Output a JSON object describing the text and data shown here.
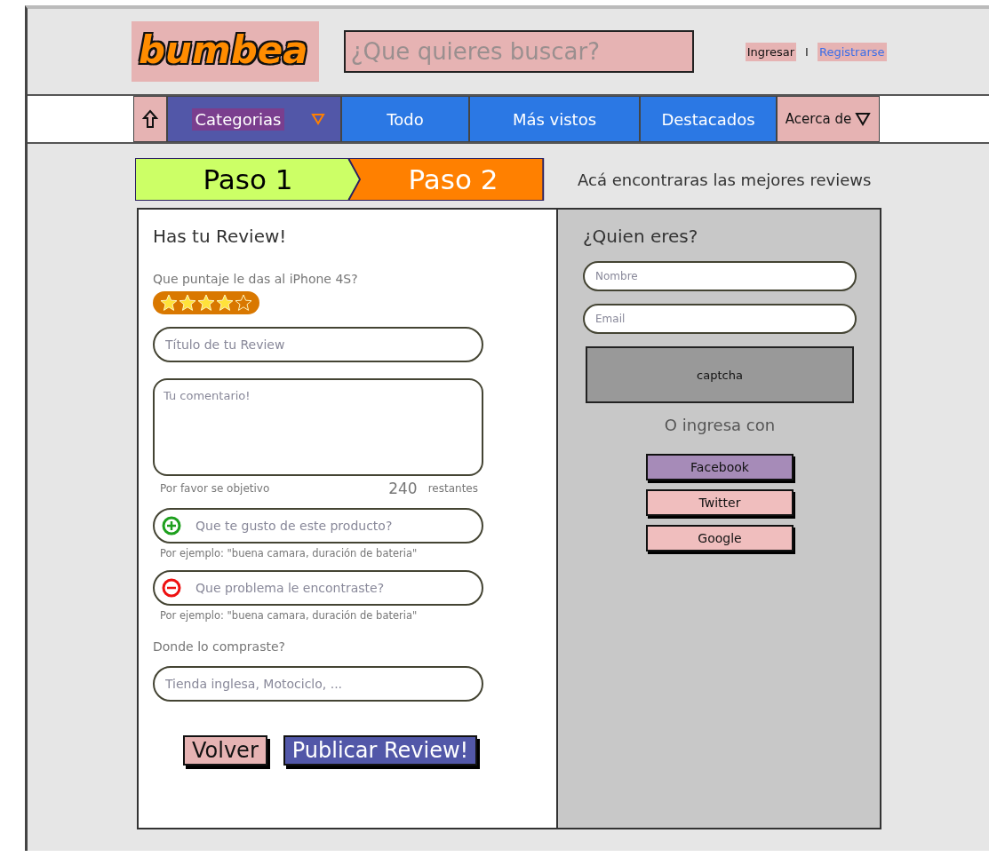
{
  "header": {
    "logo": "bumbea",
    "search": {
      "placeholder": "¿Que quieres buscar?"
    },
    "links": [
      {
        "label": "Ingresar",
        "kind": "plain"
      },
      {
        "label": "I",
        "kind": "separator"
      },
      {
        "label": "Registrarse",
        "kind": "link"
      }
    ]
  },
  "nav": [
    {
      "kind": "home"
    },
    {
      "label": "Categorias",
      "kind": "dropdown"
    },
    {
      "label": "Todo",
      "kind": "tab"
    },
    {
      "label": "Más vistos",
      "kind": "tab"
    },
    {
      "label": "Destacados",
      "kind": "tab"
    },
    {
      "label": "Acerca de",
      "kind": "menu"
    }
  ],
  "steps": [
    {
      "label": "Paso 1",
      "color": "#ccff66"
    },
    {
      "label": "Paso 2",
      "color": "#ff8000"
    }
  ],
  "tagline": "Acá encontraras las mejores reviews",
  "review": {
    "title": "Has tu Review!",
    "rating_label": "Que puntaje le das al iPhone 4S?",
    "stars": 4,
    "title_field": {
      "placeholder": "Título de tu Review"
    },
    "comment": {
      "placeholder": "Tu comentario!",
      "hint": "Por favor se objetivo",
      "remaining": "240",
      "remaining_label": "restantes"
    },
    "pros": {
      "placeholder": "Que te gusto de este producto?",
      "hint": "Por ejemplo: \"buena camara, duración de bateria\""
    },
    "cons": {
      "placeholder": "Que problema le encontraste?",
      "hint": "Por ejemplo: \"buena camara, duración de bateria\""
    },
    "store_label": "Donde lo compraste?",
    "store": {
      "placeholder": "Tienda inglesa, Motociclo, ..."
    },
    "buttons": [
      {
        "label": "Volver",
        "kind": "secondary"
      },
      {
        "label": "Publicar Review!",
        "kind": "primary"
      }
    ]
  },
  "identity": {
    "title": "¿Quien eres?",
    "name": {
      "placeholder": "Nombre"
    },
    "email": {
      "placeholder": "Email"
    },
    "captcha": "captcha",
    "alt_label": "O ingresa con",
    "social": [
      {
        "label": "Facebook",
        "color": "#a68bb8"
      },
      {
        "label": "Twitter",
        "color": "#f0bebe"
      },
      {
        "label": "Google",
        "color": "#f0bebe"
      }
    ]
  }
}
